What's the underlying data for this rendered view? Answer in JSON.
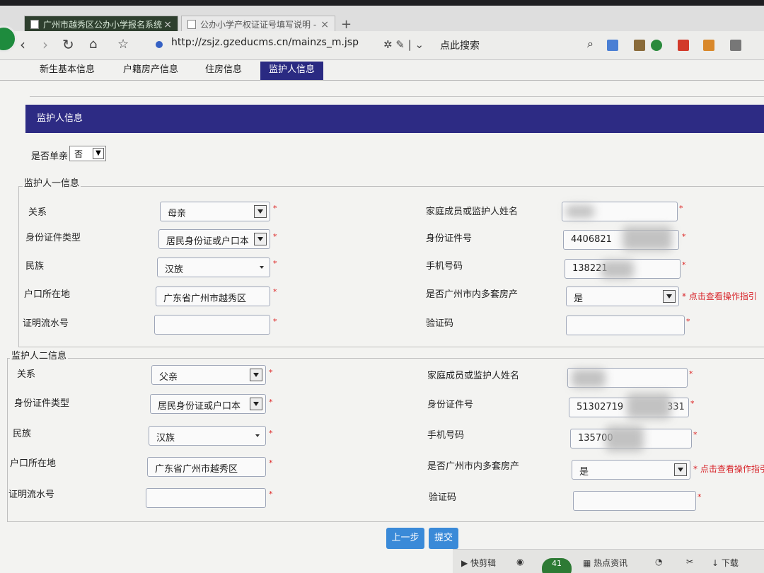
{
  "browser": {
    "tabs": [
      {
        "label": "广州市越秀区公办小学报名系统",
        "active": true
      },
      {
        "label": "公办小学产权证证号填写说明 - ",
        "active": false
      }
    ],
    "new_tab": "+",
    "url": "http://zsjz.gzeducms.cn/mainzs_m.jsp",
    "search_label": "点此搜索"
  },
  "page_tabs": [
    "新生基本信息",
    "户籍房产信息",
    "住房信息",
    "监护人信息"
  ],
  "section_title": "监护人信息",
  "single_parent": {
    "label": "是否单亲",
    "value": "否"
  },
  "guardian1": {
    "legend": "监护人一信息",
    "relation_label": "关系",
    "relation_value": "母亲",
    "id_type_label": "身份证件类型",
    "id_type_value": "居民身份证或户口本",
    "ethnicity_label": "民族",
    "ethnicity_value": "汉族",
    "hukou_label": "户口所在地",
    "hukou_value": "广东省广州市越秀区",
    "serial_label": "证明流水号",
    "serial_value": "",
    "name_label": "家庭成员或监护人姓名",
    "name_value": "",
    "id_no_label": "身份证件号",
    "id_no_value": "4406821",
    "phone_label": "手机号码",
    "phone_value": "138221",
    "multi_label": "是否广州市内多套房产",
    "multi_value": "是",
    "hint": "点击查看操作指引",
    "captcha_label": "验证码",
    "captcha_value": ""
  },
  "guardian2": {
    "legend": "监护人二信息",
    "relation_label": "关系",
    "relation_value": "父亲",
    "id_type_label": "身份证件类型",
    "id_type_value": "居民身份证或户口本",
    "ethnicity_label": "民族",
    "ethnicity_value": "汉族",
    "hukou_label": "户口所在地",
    "hukou_value": "广东省广州市越秀区",
    "serial_label": "证明流水号",
    "serial_value": "",
    "name_label": "家庭成员或监护人姓名",
    "name_value": "",
    "id_no_label": "身份证件号",
    "id_no_value": "51302719",
    "id_no_tail": "331",
    "phone_label": "手机号码",
    "phone_value": "135700",
    "multi_label": "是否广州市内多套房产",
    "multi_value": "是",
    "hint": "点击查看操作指引",
    "captcha_label": "验证码",
    "captcha_value": ""
  },
  "buttons": {
    "prev": "上一步",
    "submit": "提交"
  },
  "statusbar": {
    "clip": "快剪辑",
    "news": "热点资讯",
    "download": "下载",
    "badge": "41"
  },
  "required_mark": "*",
  "colors": {
    "section_bar": "#2d2b84",
    "button": "#3a8ad8",
    "hint": "#d8242a"
  }
}
